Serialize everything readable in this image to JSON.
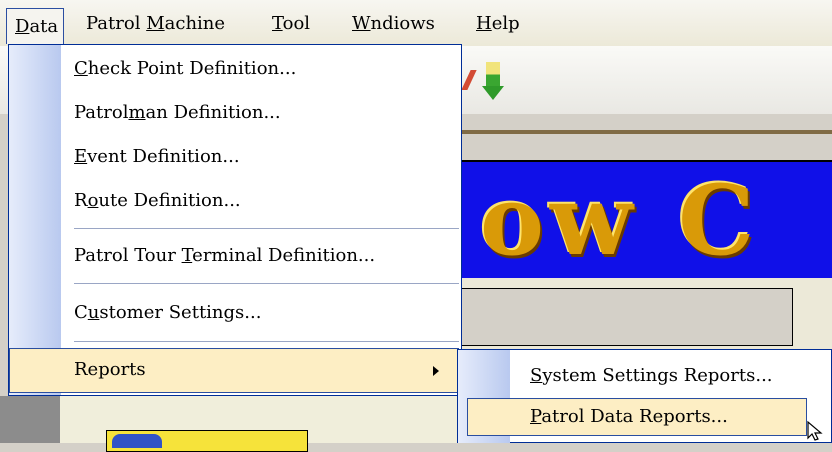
{
  "menubar": {
    "items": [
      {
        "label": "Data",
        "mnemonic": "D"
      },
      {
        "label": "Patrol Machine",
        "mnemonic": "M"
      },
      {
        "label": "Tool",
        "mnemonic": "T"
      },
      {
        "label": "Wndiows",
        "mnemonic": "W"
      },
      {
        "label": "Help",
        "mnemonic": "H"
      }
    ]
  },
  "data_menu": {
    "items": [
      {
        "pre": "",
        "u": "C",
        "post": "heck Point Definition..."
      },
      {
        "pre": "Patrol",
        "u": "m",
        "post": "an Definition..."
      },
      {
        "pre": "",
        "u": "E",
        "post": "vent Definition..."
      },
      {
        "pre": "R",
        "u": "o",
        "post": "ute Definition..."
      },
      {
        "pre": "Patrol Tour ",
        "u": "T",
        "post": "erminal Definition..."
      },
      {
        "pre": "C",
        "u": "u",
        "post": "stomer Settings..."
      },
      {
        "pre": "Reports",
        "u": "",
        "post": ""
      }
    ]
  },
  "reports_submenu": {
    "items": [
      {
        "pre": "",
        "u": "S",
        "post": "ystem Settings Reports..."
      },
      {
        "pre": "",
        "u": "P",
        "post": "atrol Data Reports..."
      }
    ]
  },
  "banner": {
    "text": "ow C"
  },
  "colors": {
    "menu_border": "#002d96",
    "highlight": "#fdeec4",
    "banner_bg": "#1010e8",
    "banner_text": "#d99a08"
  }
}
